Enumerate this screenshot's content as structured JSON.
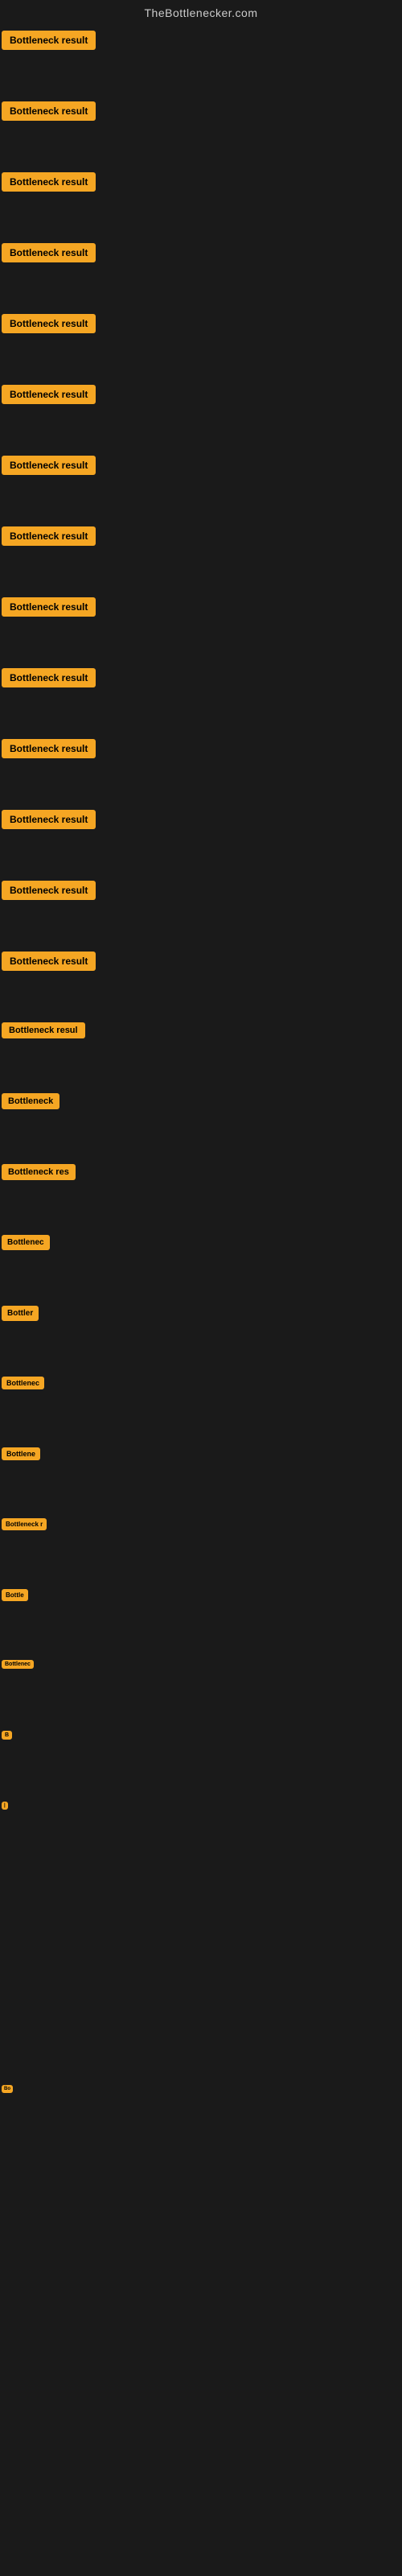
{
  "header": {
    "title": "TheBottlenecker.com"
  },
  "items": [
    {
      "id": 1,
      "label": "Bottleneck result",
      "size": "full",
      "height": 88
    },
    {
      "id": 2,
      "label": "Bottleneck result",
      "size": "full",
      "height": 88
    },
    {
      "id": 3,
      "label": "Bottleneck result",
      "size": "full",
      "height": 88
    },
    {
      "id": 4,
      "label": "Bottleneck result",
      "size": "full",
      "height": 88
    },
    {
      "id": 5,
      "label": "Bottleneck result",
      "size": "full",
      "height": 88
    },
    {
      "id": 6,
      "label": "Bottleneck result",
      "size": "full",
      "height": 88
    },
    {
      "id": 7,
      "label": "Bottleneck result",
      "size": "full",
      "height": 88
    },
    {
      "id": 8,
      "label": "Bottleneck result",
      "size": "full",
      "height": 88
    },
    {
      "id": 9,
      "label": "Bottleneck result",
      "size": "full",
      "height": 88
    },
    {
      "id": 10,
      "label": "Bottleneck result",
      "size": "full",
      "height": 88
    },
    {
      "id": 11,
      "label": "Bottleneck result",
      "size": "full",
      "height": 88
    },
    {
      "id": 12,
      "label": "Bottleneck result",
      "size": "full",
      "height": 88
    },
    {
      "id": 13,
      "label": "Bottleneck result",
      "size": "full",
      "height": 88
    },
    {
      "id": 14,
      "label": "Bottleneck result",
      "size": "full",
      "height": 88
    },
    {
      "id": 15,
      "label": "Bottleneck resul",
      "size": "lg",
      "height": 88
    },
    {
      "id": 16,
      "label": "Bottleneck",
      "size": "md",
      "height": 88
    },
    {
      "id": 17,
      "label": "Bottleneck res",
      "size": "md",
      "height": 88
    },
    {
      "id": 18,
      "label": "Bottlenec",
      "size": "sm",
      "height": 88
    },
    {
      "id": 19,
      "label": "Bottler",
      "size": "sm",
      "height": 88
    },
    {
      "id": 20,
      "label": "Bottlenec",
      "size": "xs",
      "height": 88
    },
    {
      "id": 21,
      "label": "Bottlene",
      "size": "xs",
      "height": 88
    },
    {
      "id": 22,
      "label": "Bottleneck r",
      "size": "xxs",
      "height": 88
    },
    {
      "id": 23,
      "label": "Bottle",
      "size": "xxs",
      "height": 88
    },
    {
      "id": 24,
      "label": "Bottlenec",
      "size": "tiny",
      "height": 88
    },
    {
      "id": 25,
      "label": "B",
      "size": "tiny",
      "height": 88
    },
    {
      "id": 26,
      "label": "|",
      "size": "micro",
      "height": 88
    },
    {
      "id": 27,
      "label": "",
      "size": "micro",
      "height": 88
    },
    {
      "id": 28,
      "label": "",
      "size": "micro",
      "height": 88
    },
    {
      "id": 29,
      "label": "",
      "size": "micro",
      "height": 88
    },
    {
      "id": 30,
      "label": "Bo",
      "size": "micro",
      "height": 88
    },
    {
      "id": 31,
      "label": "",
      "size": "micro",
      "height": 88
    },
    {
      "id": 32,
      "label": "",
      "size": "micro",
      "height": 88
    },
    {
      "id": 33,
      "label": "",
      "size": "micro",
      "height": 88
    },
    {
      "id": 34,
      "label": "",
      "size": "micro",
      "height": 88
    },
    {
      "id": 35,
      "label": "",
      "size": "micro",
      "height": 88
    },
    {
      "id": 36,
      "label": "",
      "size": "micro",
      "height": 88
    }
  ],
  "colors": {
    "background": "#1a1a1a",
    "header_text": "#cccccc",
    "badge_bg": "#f5a623",
    "badge_text": "#000000"
  }
}
